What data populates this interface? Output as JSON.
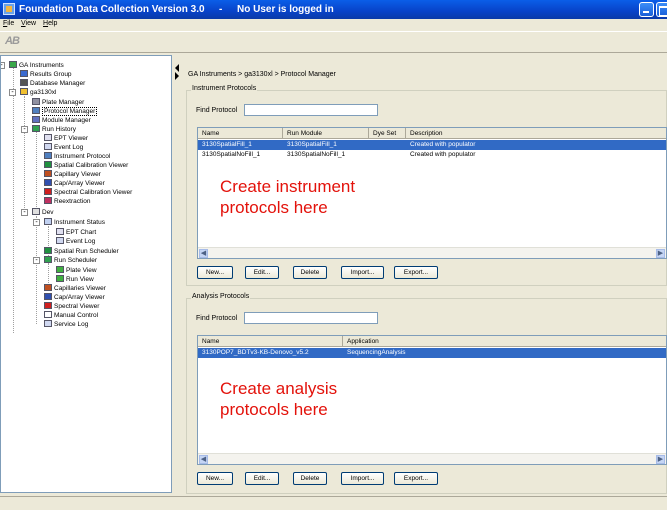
{
  "window": {
    "title": "Foundation Data Collection Version 3.0",
    "separator": "-",
    "user_status": "No User is logged in"
  },
  "menu": [
    "File",
    "View",
    "Help"
  ],
  "toolbar": {
    "logo": "AB"
  },
  "tree": [
    {
      "label": "GA Instruments",
      "icon": "instrument-icon",
      "color": "#3aa84a"
    },
    {
      "label": "Results Group",
      "icon": "results-group-icon",
      "color": "#3a6ad0"
    },
    {
      "label": "Database Manager",
      "icon": "database-icon",
      "color": "#555555"
    },
    {
      "label": "ga3130xl",
      "icon": "instrument-icon",
      "color": "#f0c030"
    },
    {
      "label": "Plate Manager",
      "icon": "plate-icon",
      "color": "#9090a0"
    },
    {
      "label": "Protocol Manager",
      "icon": "protocol-icon",
      "color": "#5080c0",
      "selected": true
    },
    {
      "label": "Module Manager",
      "icon": "module-icon",
      "color": "#6070c0"
    },
    {
      "label": "Run History",
      "icon": "run-history-icon",
      "color": "#30a050"
    },
    {
      "label": "EPT Viewer",
      "icon": "chart-icon",
      "color": "#e0e0f0"
    },
    {
      "label": "Event Log",
      "icon": "log-icon",
      "color": "#d0d8f0"
    },
    {
      "label": "Instrument Protocol",
      "icon": "protocol-icon",
      "color": "#5080c0"
    },
    {
      "label": "Spatial Calibration Viewer",
      "icon": "spatial-icon",
      "color": "#209040"
    },
    {
      "label": "Capillary Viewer",
      "icon": "capillary-icon",
      "color": "#c05020"
    },
    {
      "label": "Cap/Array Viewer",
      "icon": "array-icon",
      "color": "#3050b0"
    },
    {
      "label": "Spectral Calibration Viewer",
      "icon": "spectral-icon",
      "color": "#d02020"
    },
    {
      "label": "Reextraction",
      "icon": "reextraction-icon",
      "color": "#c03060"
    },
    {
      "label": "Dev",
      "icon": "folder-icon",
      "color": "#e0e0e0"
    },
    {
      "label": "Instrument Status",
      "icon": "status-icon",
      "color": "#c0d0f0"
    },
    {
      "label": "EPT Chart",
      "icon": "chart-icon",
      "color": "#e0e0f0"
    },
    {
      "label": "Event Log",
      "icon": "log-icon",
      "color": "#d0d8f0"
    },
    {
      "label": "Spatial Run Scheduler",
      "icon": "spatial-icon",
      "color": "#209040"
    },
    {
      "label": "Run Scheduler",
      "icon": "scheduler-icon",
      "color": "#30a050"
    },
    {
      "label": "Plate View",
      "icon": "plate-view-icon",
      "color": "#40b040"
    },
    {
      "label": "Run View",
      "icon": "run-view-icon",
      "color": "#40b040"
    },
    {
      "label": "Capillaries Viewer",
      "icon": "capillary-icon",
      "color": "#c05020"
    },
    {
      "label": "Cap/Array Viewer",
      "icon": "array-icon",
      "color": "#3050b0"
    },
    {
      "label": "Spectral Viewer",
      "icon": "spectral-icon",
      "color": "#d02020"
    },
    {
      "label": "Manual Control",
      "icon": "hand-icon",
      "color": "#ffffff"
    },
    {
      "label": "Service Log",
      "icon": "log-icon",
      "color": "#d0d8f0"
    }
  ],
  "breadcrumb": "GA Instruments > ga3130xl > Protocol Manager",
  "instrument_protocols": {
    "legend": "Instrument Protocols",
    "find_label": "Find Protocol",
    "find_value": "",
    "columns": [
      "Name",
      "Run Module",
      "Dye Set",
      "Description"
    ],
    "rows": [
      {
        "cells": [
          "3130SpatialFill_1",
          "3130SpatialFill_1",
          "",
          "Created with populator"
        ],
        "selected": true
      },
      {
        "cells": [
          "3130SpatialNoFill_1",
          "3130SpatialNoFill_1",
          "",
          "Created with populator"
        ],
        "selected": false
      }
    ],
    "note": [
      "Create instrument",
      "protocols here"
    ],
    "buttons": [
      "New...",
      "Edit...",
      "Delete",
      "Import...",
      "Export..."
    ]
  },
  "analysis_protocols": {
    "legend": "Analysis Protocols",
    "find_label": "Find Protocol",
    "find_value": "",
    "columns": [
      "Name",
      "Application"
    ],
    "rows": [
      {
        "cells": [
          "3130POP7_BDTv3-KB-Denovo_v5.2",
          "SequencingAnalysis"
        ],
        "selected": true
      }
    ],
    "note": [
      "Create analysis",
      "protocols here"
    ],
    "buttons": [
      "New...",
      "Edit...",
      "Delete",
      "Import...",
      "Export..."
    ]
  },
  "colors": {
    "title_bar": "#0842c8",
    "selection": "#316ac5",
    "note_text": "#e3120b"
  }
}
